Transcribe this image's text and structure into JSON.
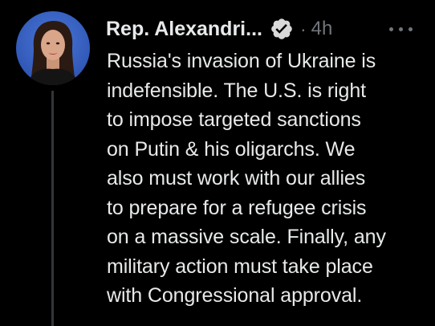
{
  "tweet": {
    "author_name": "Rep. Alexandri...",
    "separator": "·",
    "timestamp": "4h",
    "icons": {
      "verified": "verified-badge-icon",
      "more": "more-options-icon"
    },
    "colors": {
      "background": "#000000",
      "text": "#e7e9ea",
      "secondary": "#71767b",
      "thread_line": "#333639"
    },
    "body_lines": [
      "Russia's invasion of Ukraine is",
      "indefensible.  The U.S. is right",
      "to impose targeted sanctions",
      "on Putin & his oligarchs. We",
      "also must work with our allies",
      "to prepare for a refugee crisis",
      "on a massive scale. Finally, any",
      "military action must take place",
      "with Congressional approval."
    ]
  }
}
